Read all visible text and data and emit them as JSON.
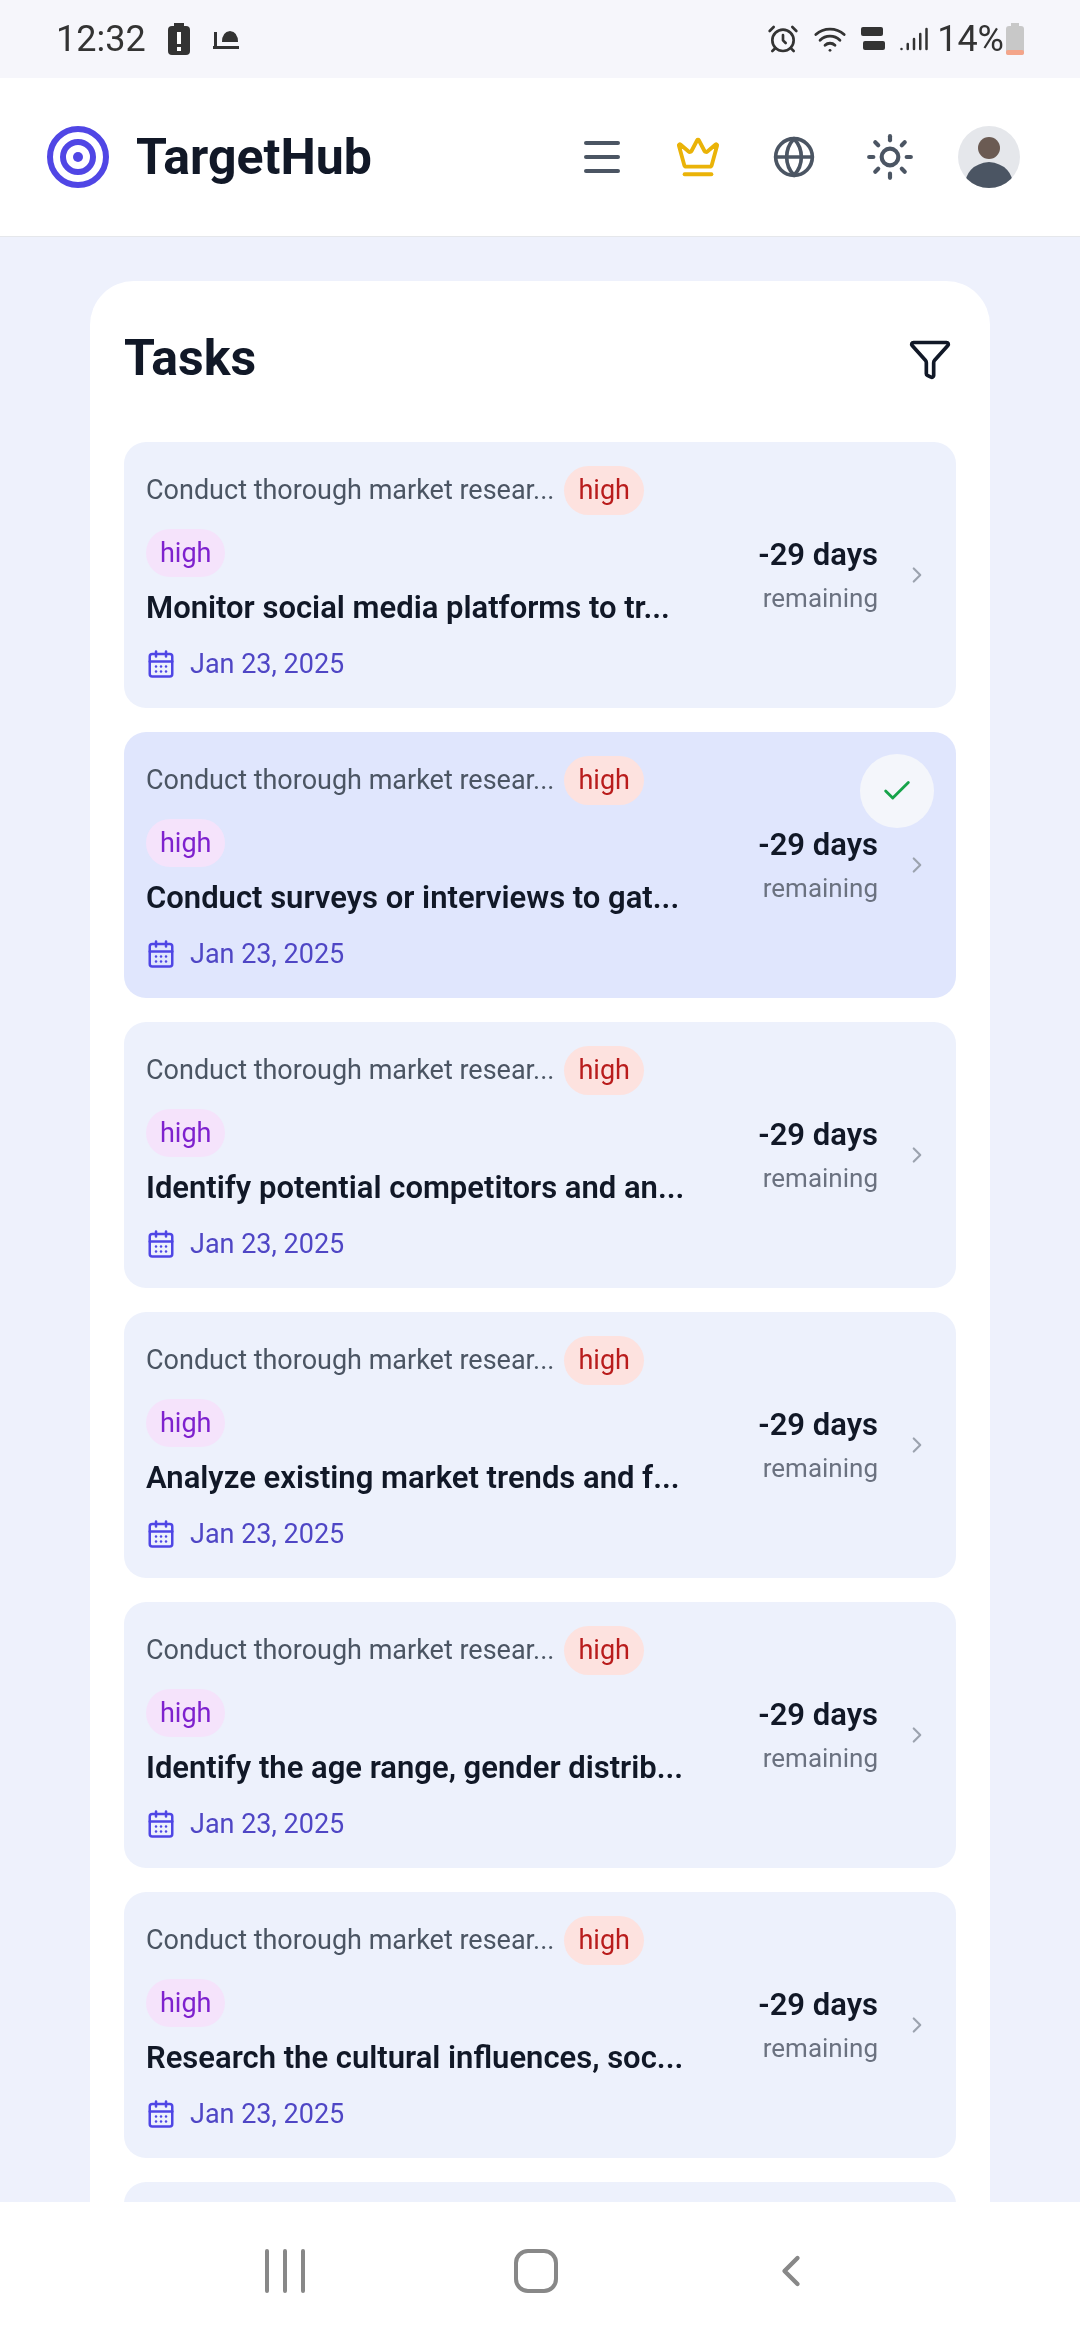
{
  "status_bar": {
    "time": "12:32",
    "battery": "14%"
  },
  "header": {
    "app_name": "TargetHub"
  },
  "panel": {
    "title": "Tasks"
  },
  "tasks": [
    {
      "parent": "Conduct thorough market resear...",
      "parent_priority": "high",
      "priority": "high",
      "title": "Monitor social media platforms to tr...",
      "days": "-29 days",
      "remaining": "remaining",
      "date": "Jan 23, 2025",
      "selected": false
    },
    {
      "parent": "Conduct thorough market resear...",
      "parent_priority": "high",
      "priority": "high",
      "title": "Conduct surveys or interviews to gat...",
      "days": "-29 days",
      "remaining": "remaining",
      "date": "Jan 23, 2025",
      "selected": true
    },
    {
      "parent": "Conduct thorough market resear...",
      "parent_priority": "high",
      "priority": "high",
      "title": "Identify potential competitors and an...",
      "days": "-29 days",
      "remaining": "remaining",
      "date": "Jan 23, 2025",
      "selected": false
    },
    {
      "parent": "Conduct thorough market resear...",
      "parent_priority": "high",
      "priority": "high",
      "title": "Analyze existing market trends and f...",
      "days": "-29 days",
      "remaining": "remaining",
      "date": "Jan 23, 2025",
      "selected": false
    },
    {
      "parent": "Conduct thorough market resear...",
      "parent_priority": "high",
      "priority": "high",
      "title": "Identify the age range, gender distrib...",
      "days": "-29 days",
      "remaining": "remaining",
      "date": "Jan 23, 2025",
      "selected": false
    },
    {
      "parent": "Conduct thorough market resear...",
      "parent_priority": "high",
      "priority": "high",
      "title": "Research the cultural influences, soc...",
      "days": "-29 days",
      "remaining": "remaining",
      "date": "Jan 23, 2025",
      "selected": false
    }
  ]
}
